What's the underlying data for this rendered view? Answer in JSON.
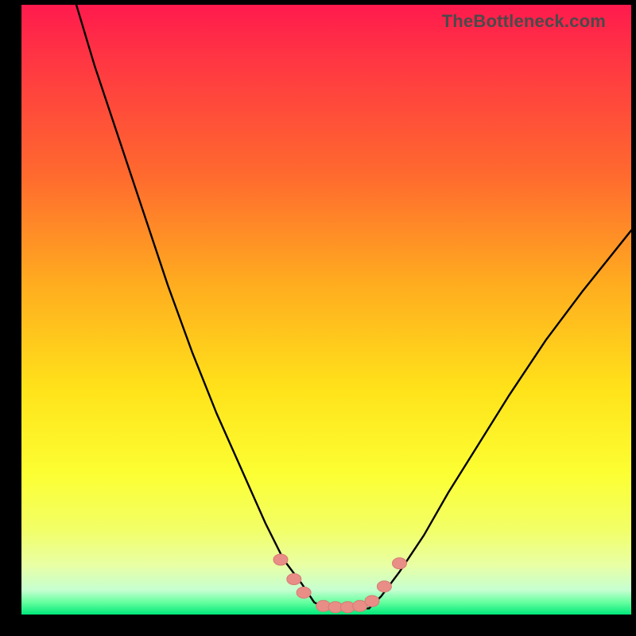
{
  "watermark": "TheBottleneck.com",
  "colors": {
    "gradient_top": "#ff1a4d",
    "gradient_mid": "#ffe21a",
    "gradient_bottom": "#00e87a",
    "curve": "#000000",
    "bead_fill": "#e98d87",
    "bead_stroke": "#d77a74",
    "frame": "#000000"
  },
  "chart_data": {
    "type": "line",
    "title": "",
    "xlabel": "",
    "ylabel": "",
    "xlim": [
      0,
      100
    ],
    "ylim": [
      0,
      100
    ],
    "grid": false,
    "legend": false,
    "series": [
      {
        "name": "left-curve",
        "x": [
          9,
          12,
          16,
          20,
          24,
          28,
          32,
          36,
          40,
          43,
          46,
          48,
          50
        ],
        "y": [
          100,
          90,
          78,
          66,
          54,
          43,
          33,
          24,
          15,
          9,
          5,
          2,
          1
        ]
      },
      {
        "name": "right-curve",
        "x": [
          57,
          59,
          62,
          66,
          70,
          75,
          80,
          86,
          92,
          100
        ],
        "y": [
          1,
          3,
          7,
          13,
          20,
          28,
          36,
          45,
          53,
          63
        ]
      },
      {
        "name": "flat-bottom",
        "x": [
          50,
          51,
          53,
          55,
          57
        ],
        "y": [
          1,
          1,
          1,
          1,
          1
        ]
      }
    ],
    "bead_points": {
      "x": [
        42.5,
        44.7,
        46.3,
        49.5,
        51.5,
        53.5,
        55.5,
        57.5,
        59.5,
        62.0
      ],
      "y": [
        9.0,
        5.8,
        3.6,
        1.4,
        1.2,
        1.2,
        1.4,
        2.2,
        4.6,
        8.4
      ]
    }
  }
}
